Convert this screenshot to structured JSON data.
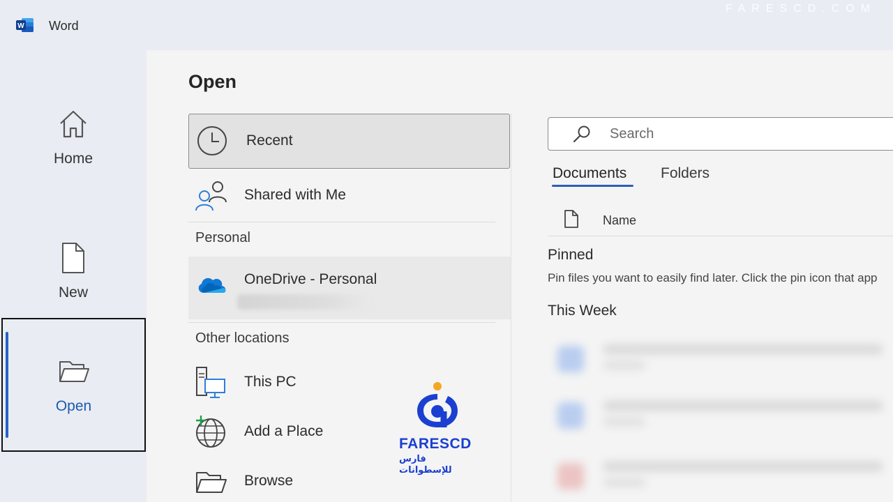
{
  "titlebar": {
    "app_name": "Word",
    "watermark": "FARESCD.COM"
  },
  "rail": {
    "home_label": "Home",
    "new_label": "New",
    "open_label": "Open"
  },
  "main": {
    "title": "Open",
    "locations": {
      "recent": "Recent",
      "shared": "Shared with Me",
      "personal_header": "Personal",
      "onedrive": "OneDrive - Personal",
      "other_header": "Other locations",
      "this_pc": "This PC",
      "add_place": "Add a Place",
      "browse": "Browse"
    },
    "search": {
      "placeholder": "Search"
    },
    "tabs": {
      "documents": "Documents",
      "folders": "Folders"
    },
    "columns": {
      "name": "Name"
    },
    "pinned": {
      "header": "Pinned",
      "description": "Pin files you want to easily find later. Click the pin icon that app"
    },
    "this_week": {
      "header": "This Week"
    }
  },
  "watermark_logo": {
    "brand": "FARESCD",
    "arabic": "فارس للإسطوانات"
  },
  "colors": {
    "accent": "#2563c4",
    "word_blue": "#185abd",
    "onedrive_blue": "#0f78d4"
  }
}
